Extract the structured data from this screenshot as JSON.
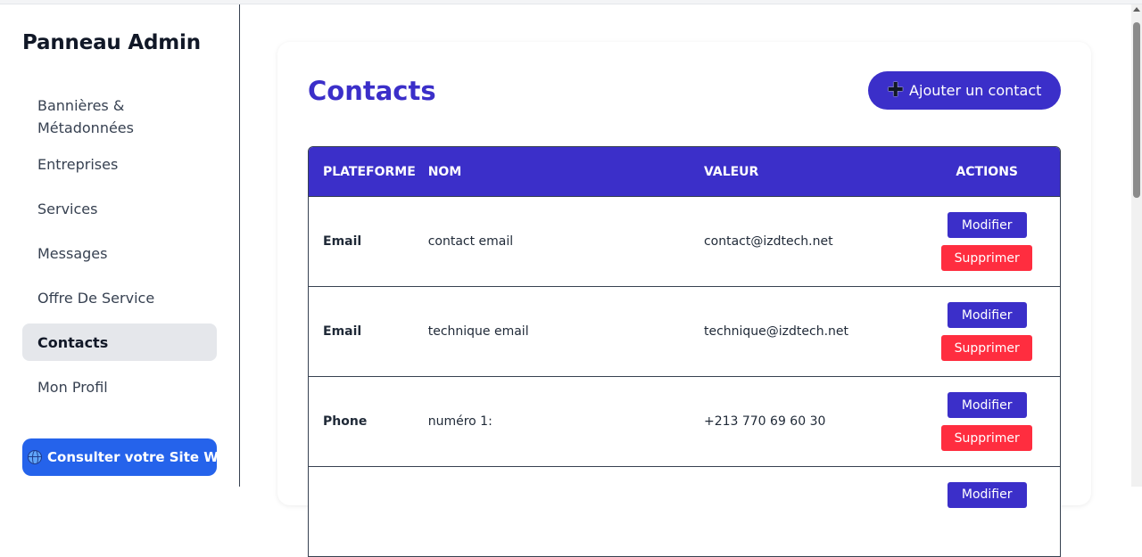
{
  "sidebar": {
    "title": "Panneau Admin",
    "items": [
      {
        "label": "Bannières & Métadonnées"
      },
      {
        "label": "Entreprises"
      },
      {
        "label": "Services"
      },
      {
        "label": "Messages"
      },
      {
        "label": "Offre De Service"
      },
      {
        "label": "Contacts",
        "active": true
      },
      {
        "label": "Mon Profil"
      }
    ],
    "site_button": {
      "label": "Consulter votre Site Web",
      "icon": "globe-icon"
    }
  },
  "main": {
    "title": "Contacts",
    "add_button": {
      "label": "Ajouter un contact",
      "icon": "plus-icon"
    },
    "table": {
      "headers": [
        "PLATEFORME",
        "NOM",
        "VALEUR",
        "ACTIONS"
      ],
      "rows": [
        {
          "platform": "Email",
          "name": "contact email",
          "value": "contact@izdtech.net"
        },
        {
          "platform": "Email",
          "name": "technique email",
          "value": "technique@izdtech.net"
        },
        {
          "platform": "Phone",
          "name": "numéro 1:",
          "value": "+213 770 69 60 30"
        }
      ],
      "edit_label": "Modifier",
      "delete_label": "Supprimer"
    }
  },
  "colors": {
    "accent": "#3b2fc9",
    "danger": "#ff2d3f",
    "link_button": "#2563eb",
    "active_nav": "#e5e7eb"
  }
}
